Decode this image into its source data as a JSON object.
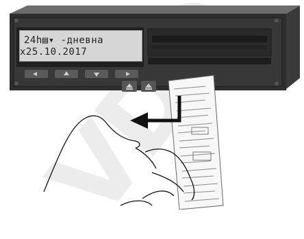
{
  "display": {
    "line1": "24h▤▾ -дневна",
    "line2": "x25.10.2017"
  },
  "watermark": {
    "text": "VDO"
  },
  "colors": {
    "panel": "#2e2e2e",
    "lcd_bg": "#d6d6d6",
    "arrow": "#1a1a1a",
    "paper": "#f7f7f7"
  },
  "icons": {
    "arrow": "left-arrow-icon",
    "eject1": "eject-icon",
    "eject2": "eject-icon"
  }
}
